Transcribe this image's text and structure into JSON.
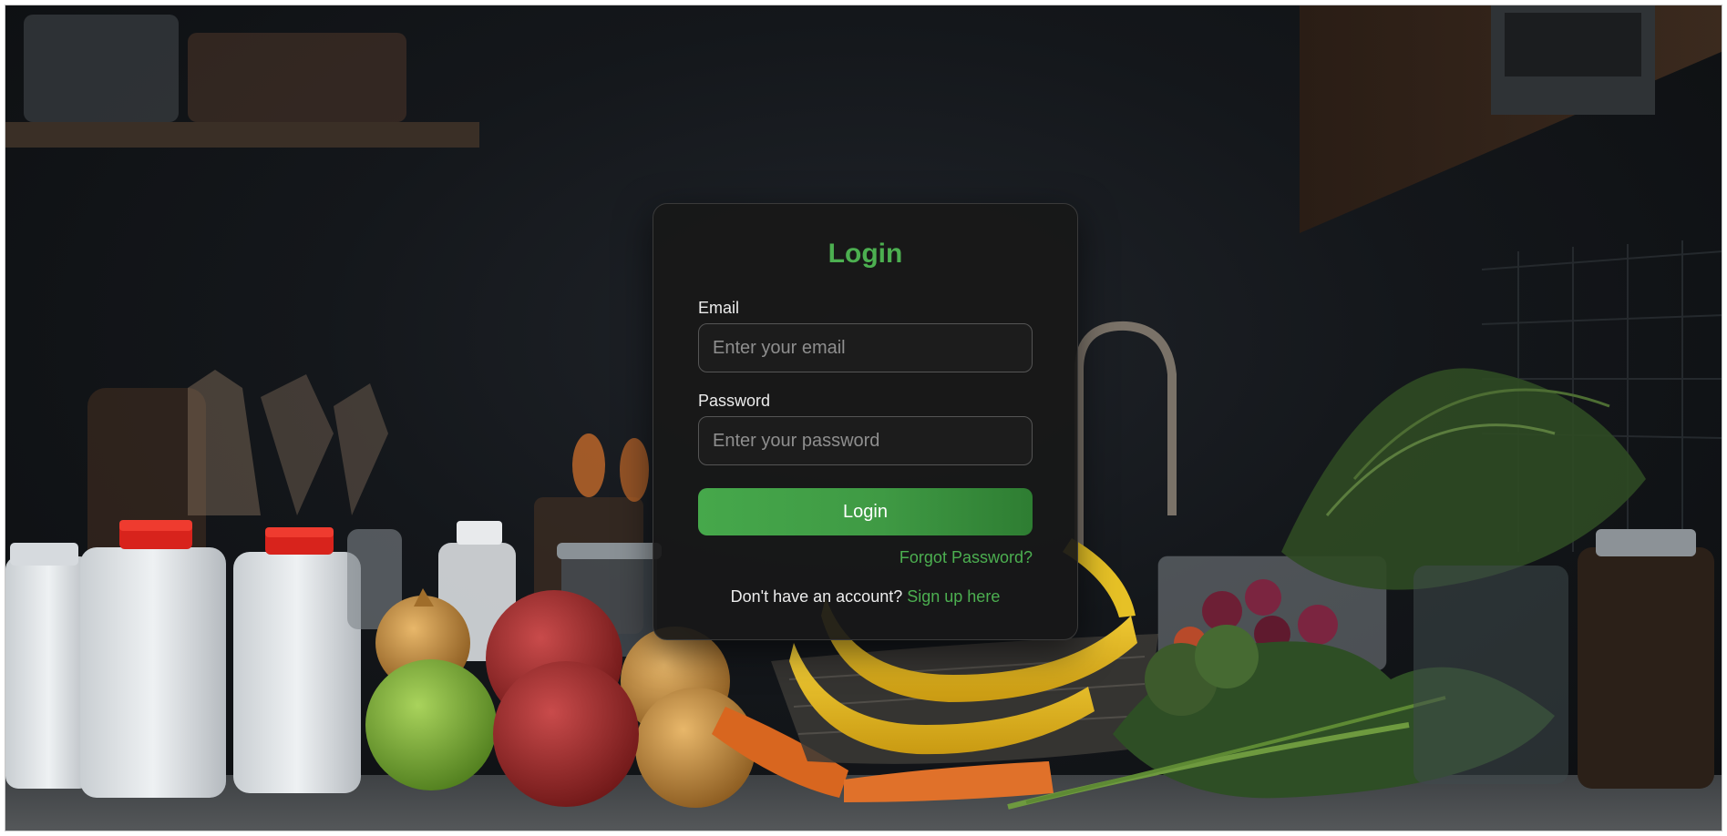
{
  "login": {
    "title": "Login",
    "email_label": "Email",
    "email_placeholder": "Enter your email",
    "email_value": "",
    "password_label": "Password",
    "password_placeholder": "Enter your password",
    "password_value": "",
    "submit_label": "Login",
    "forgot_password": "Forgot Password?",
    "signup_prompt": "Don't have an account?",
    "signup_link": "Sign up here"
  },
  "theme": {
    "accent": "#4caf50",
    "card_background": "#181818",
    "button_gradient_end": "#2e7d32"
  },
  "background": {
    "subject": "kitchen-counter-groceries"
  }
}
